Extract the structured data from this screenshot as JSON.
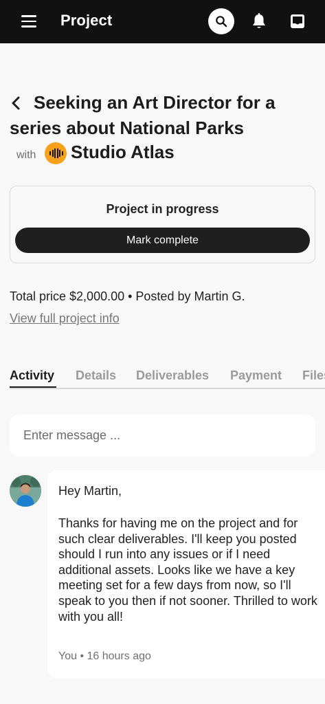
{
  "header": {
    "title": "Project",
    "icons": [
      "hamburger-menu-icon",
      "search-icon",
      "bell-icon",
      "inbox-icon"
    ]
  },
  "project": {
    "title": "Seeking an Art Director for a series about National Parks",
    "with_label": "with",
    "studio_name": "Studio Atlas",
    "status": "Project in progress",
    "mark_complete_label": "Mark complete",
    "price_line": "Total price $2,000.00 • Posted by Martin G.",
    "view_info_label": "View full project info"
  },
  "tabs": [
    {
      "label": "Activity",
      "active": true
    },
    {
      "label": "Details",
      "active": false
    },
    {
      "label": "Deliverables",
      "active": false
    },
    {
      "label": "Payment",
      "active": false
    },
    {
      "label": "Files",
      "active": false
    }
  ],
  "message_input": {
    "placeholder": "Enter message ..."
  },
  "message": {
    "greeting": "Hey Martin,",
    "body": "Thanks for having me on the project and for such clear deliverables. I'll keep you posted should I run into any issues or if I need additional assets. Looks like we have a key meeting set for a few days from now, so I'll speak to you then if not sooner. Thrilled to work with you all!",
    "meta": "You • 16 hours ago"
  },
  "colors": {
    "topbar": "#111111",
    "background": "#f8f8f8",
    "studio_logo": "#f5a11b",
    "button": "#1f1f1f"
  }
}
